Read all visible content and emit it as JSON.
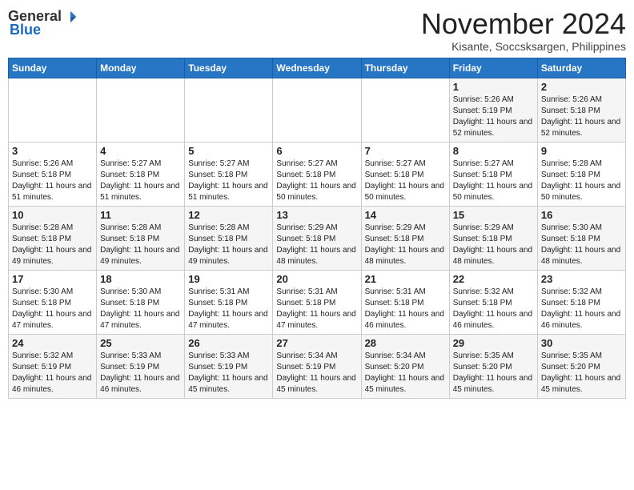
{
  "header": {
    "logo_general": "General",
    "logo_blue": "Blue",
    "month_title": "November 2024",
    "location": "Kisante, Soccsksargen, Philippines"
  },
  "weekdays": [
    "Sunday",
    "Monday",
    "Tuesday",
    "Wednesday",
    "Thursday",
    "Friday",
    "Saturday"
  ],
  "weeks": [
    [
      {
        "day": "",
        "info": ""
      },
      {
        "day": "",
        "info": ""
      },
      {
        "day": "",
        "info": ""
      },
      {
        "day": "",
        "info": ""
      },
      {
        "day": "",
        "info": ""
      },
      {
        "day": "1",
        "info": "Sunrise: 5:26 AM\nSunset: 5:19 PM\nDaylight: 11 hours and 52 minutes."
      },
      {
        "day": "2",
        "info": "Sunrise: 5:26 AM\nSunset: 5:18 PM\nDaylight: 11 hours and 52 minutes."
      }
    ],
    [
      {
        "day": "3",
        "info": "Sunrise: 5:26 AM\nSunset: 5:18 PM\nDaylight: 11 hours and 51 minutes."
      },
      {
        "day": "4",
        "info": "Sunrise: 5:27 AM\nSunset: 5:18 PM\nDaylight: 11 hours and 51 minutes."
      },
      {
        "day": "5",
        "info": "Sunrise: 5:27 AM\nSunset: 5:18 PM\nDaylight: 11 hours and 51 minutes."
      },
      {
        "day": "6",
        "info": "Sunrise: 5:27 AM\nSunset: 5:18 PM\nDaylight: 11 hours and 50 minutes."
      },
      {
        "day": "7",
        "info": "Sunrise: 5:27 AM\nSunset: 5:18 PM\nDaylight: 11 hours and 50 minutes."
      },
      {
        "day": "8",
        "info": "Sunrise: 5:27 AM\nSunset: 5:18 PM\nDaylight: 11 hours and 50 minutes."
      },
      {
        "day": "9",
        "info": "Sunrise: 5:28 AM\nSunset: 5:18 PM\nDaylight: 11 hours and 50 minutes."
      }
    ],
    [
      {
        "day": "10",
        "info": "Sunrise: 5:28 AM\nSunset: 5:18 PM\nDaylight: 11 hours and 49 minutes."
      },
      {
        "day": "11",
        "info": "Sunrise: 5:28 AM\nSunset: 5:18 PM\nDaylight: 11 hours and 49 minutes."
      },
      {
        "day": "12",
        "info": "Sunrise: 5:28 AM\nSunset: 5:18 PM\nDaylight: 11 hours and 49 minutes."
      },
      {
        "day": "13",
        "info": "Sunrise: 5:29 AM\nSunset: 5:18 PM\nDaylight: 11 hours and 48 minutes."
      },
      {
        "day": "14",
        "info": "Sunrise: 5:29 AM\nSunset: 5:18 PM\nDaylight: 11 hours and 48 minutes."
      },
      {
        "day": "15",
        "info": "Sunrise: 5:29 AM\nSunset: 5:18 PM\nDaylight: 11 hours and 48 minutes."
      },
      {
        "day": "16",
        "info": "Sunrise: 5:30 AM\nSunset: 5:18 PM\nDaylight: 11 hours and 48 minutes."
      }
    ],
    [
      {
        "day": "17",
        "info": "Sunrise: 5:30 AM\nSunset: 5:18 PM\nDaylight: 11 hours and 47 minutes."
      },
      {
        "day": "18",
        "info": "Sunrise: 5:30 AM\nSunset: 5:18 PM\nDaylight: 11 hours and 47 minutes."
      },
      {
        "day": "19",
        "info": "Sunrise: 5:31 AM\nSunset: 5:18 PM\nDaylight: 11 hours and 47 minutes."
      },
      {
        "day": "20",
        "info": "Sunrise: 5:31 AM\nSunset: 5:18 PM\nDaylight: 11 hours and 47 minutes."
      },
      {
        "day": "21",
        "info": "Sunrise: 5:31 AM\nSunset: 5:18 PM\nDaylight: 11 hours and 46 minutes."
      },
      {
        "day": "22",
        "info": "Sunrise: 5:32 AM\nSunset: 5:18 PM\nDaylight: 11 hours and 46 minutes."
      },
      {
        "day": "23",
        "info": "Sunrise: 5:32 AM\nSunset: 5:18 PM\nDaylight: 11 hours and 46 minutes."
      }
    ],
    [
      {
        "day": "24",
        "info": "Sunrise: 5:32 AM\nSunset: 5:19 PM\nDaylight: 11 hours and 46 minutes."
      },
      {
        "day": "25",
        "info": "Sunrise: 5:33 AM\nSunset: 5:19 PM\nDaylight: 11 hours and 46 minutes."
      },
      {
        "day": "26",
        "info": "Sunrise: 5:33 AM\nSunset: 5:19 PM\nDaylight: 11 hours and 45 minutes."
      },
      {
        "day": "27",
        "info": "Sunrise: 5:34 AM\nSunset: 5:19 PM\nDaylight: 11 hours and 45 minutes."
      },
      {
        "day": "28",
        "info": "Sunrise: 5:34 AM\nSunset: 5:20 PM\nDaylight: 11 hours and 45 minutes."
      },
      {
        "day": "29",
        "info": "Sunrise: 5:35 AM\nSunset: 5:20 PM\nDaylight: 11 hours and 45 minutes."
      },
      {
        "day": "30",
        "info": "Sunrise: 5:35 AM\nSunset: 5:20 PM\nDaylight: 11 hours and 45 minutes."
      }
    ]
  ]
}
